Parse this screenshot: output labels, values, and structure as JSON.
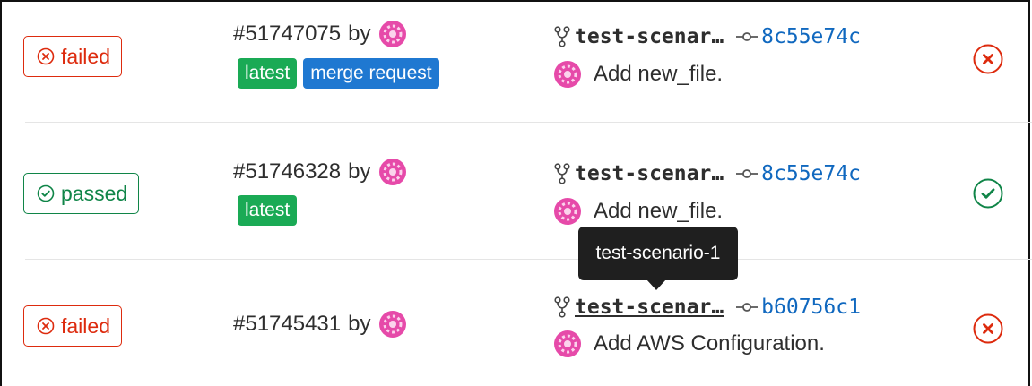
{
  "colors": {
    "failed": "#dd2b0e",
    "passed": "#108548",
    "tag_green": "#1aaa55",
    "tag_blue": "#1f78d1",
    "sha_link": "#1068bf",
    "avatar": "#e64aa9",
    "tooltip_bg": "#1f1f1f"
  },
  "pipelines": [
    {
      "status": "failed",
      "status_icon": "status-failed-icon",
      "id_text": "#51747075",
      "by_text": "by",
      "tags": [
        "latest",
        "merge request"
      ],
      "branch": "test-scenar…",
      "sha": "8c55e74c",
      "commit_message": "Add new_file.",
      "result_icon": "failed-x-circle-icon"
    },
    {
      "status": "passed",
      "status_icon": "status-passed-icon",
      "id_text": "#51746328",
      "by_text": "by",
      "tags": [
        "latest"
      ],
      "branch": "test-scenar…",
      "sha": "8c55e74c",
      "commit_message": "Add new_file.",
      "result_icon": "passed-check-circle-icon"
    },
    {
      "status": "failed",
      "status_icon": "status-failed-icon",
      "id_text": "#51745431",
      "by_text": "by",
      "tags": [],
      "branch": "test-scenar…",
      "sha": "b60756c1",
      "commit_message": "Add AWS Configuration.",
      "result_icon": "failed-x-circle-icon"
    }
  ],
  "tooltip": {
    "text": "test-scenario-1"
  }
}
